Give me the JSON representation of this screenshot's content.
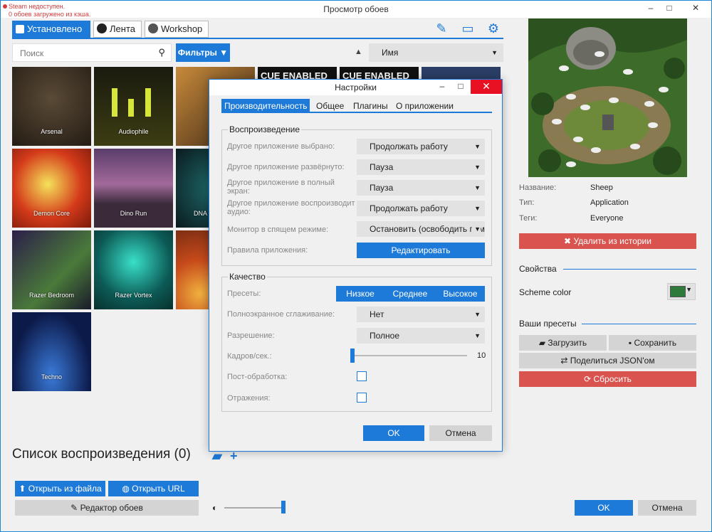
{
  "window": {
    "title": "Просмотр обоев",
    "status_line1": "Steam недоступен.",
    "status_line2": "0 обоев загружено из кэша.",
    "minimize": "–",
    "maximize": "□",
    "close": "✕"
  },
  "tabs": [
    {
      "label": "Установлено",
      "active": true
    },
    {
      "label": "Лента"
    },
    {
      "label": "Workshop"
    }
  ],
  "toolbar_icons": [
    "wand-icon",
    "monitor-icon",
    "gear-icon"
  ],
  "search": {
    "placeholder": "Поиск",
    "icon": "search-icon"
  },
  "filters_label": "Фильтры",
  "sort": {
    "direction": "▲",
    "value": "Имя"
  },
  "wallpapers": [
    "Arsenal",
    "Audiophile",
    "",
    "",
    "",
    "",
    "Demon Core",
    "Dino Run",
    "DNA",
    "Razer Bedroom",
    "Razer Vortex",
    "",
    "Techno"
  ],
  "cue_label": "CUE ENABLED",
  "playlist": {
    "title": "Список воспроизведения (0)",
    "open_file": "Открыть из файла",
    "open_url": "Открыть URL",
    "editor": "Редактор обоев"
  },
  "footer": {
    "ok": "OK",
    "cancel": "Отмена"
  },
  "details": {
    "name_key": "Название:",
    "name_val": "Sheep",
    "type_key": "Тип:",
    "type_val": "Application",
    "tags_key": "Теги:",
    "tags_val": "Everyone",
    "delete": "Удалить из истории",
    "properties": "Свойства",
    "scheme_color": "Scheme color",
    "scheme_color_value": "#2e7a3a",
    "presets": "Ваши пресеты",
    "load": "Загрузить",
    "save": "Сохранить",
    "share": "Поделиться JSON'ом",
    "reset": "Сбросить"
  },
  "settings": {
    "title": "Настройки",
    "tabs": [
      "Производительность",
      "Общее",
      "Плагины",
      "О приложении"
    ],
    "playback": {
      "label": "Воспроизведение",
      "rows": [
        {
          "label": "Другое приложение выбрано:",
          "value": "Продолжать работу"
        },
        {
          "label": "Другое приложение развёрнуто:",
          "value": "Пауза"
        },
        {
          "label": "Другое приложение в полный экран:",
          "value": "Пауза"
        },
        {
          "label": "Другое приложение воспроизводит аудио:",
          "value": "Продолжать работу"
        },
        {
          "label": "Монитор в спящем режиме:",
          "value": "Остановить (освободить память)"
        }
      ],
      "rules_label": "Правила приложения:",
      "rules_button": "Редактировать"
    },
    "quality": {
      "label": "Качество",
      "presets_label": "Пресеты:",
      "presets": [
        "Низкое",
        "Среднее",
        "Высокое"
      ],
      "aa_label": "Полноэкранное сглаживание:",
      "aa_value": "Нет",
      "res_label": "Разрешение:",
      "res_value": "Полное",
      "fps_label": "Кадров/сек.:",
      "fps_value": "10",
      "post_label": "Пост-обработка:",
      "reflect_label": "Отражения:"
    },
    "ok": "OK",
    "cancel": "Отмена"
  }
}
